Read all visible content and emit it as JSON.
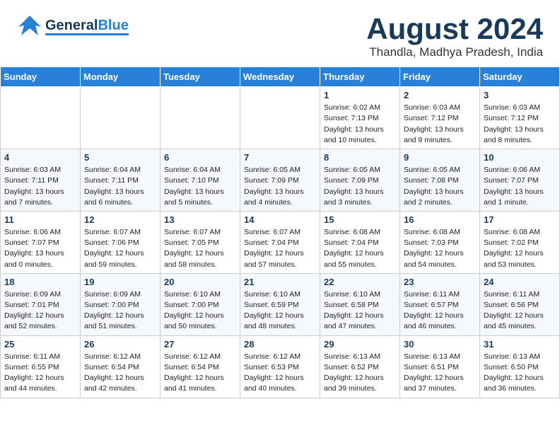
{
  "header": {
    "logo": {
      "general": "General",
      "blue": "Blue"
    },
    "month": "August 2024",
    "location": "Thandla, Madhya Pradesh, India"
  },
  "weekdays": [
    "Sunday",
    "Monday",
    "Tuesday",
    "Wednesday",
    "Thursday",
    "Friday",
    "Saturday"
  ],
  "weeks": [
    [
      {
        "day": "",
        "text": ""
      },
      {
        "day": "",
        "text": ""
      },
      {
        "day": "",
        "text": ""
      },
      {
        "day": "",
        "text": ""
      },
      {
        "day": "1",
        "text": "Sunrise: 6:02 AM\nSunset: 7:13 PM\nDaylight: 13 hours\nand 10 minutes."
      },
      {
        "day": "2",
        "text": "Sunrise: 6:03 AM\nSunset: 7:12 PM\nDaylight: 13 hours\nand 9 minutes."
      },
      {
        "day": "3",
        "text": "Sunrise: 6:03 AM\nSunset: 7:12 PM\nDaylight: 13 hours\nand 8 minutes."
      }
    ],
    [
      {
        "day": "4",
        "text": "Sunrise: 6:03 AM\nSunset: 7:11 PM\nDaylight: 13 hours\nand 7 minutes."
      },
      {
        "day": "5",
        "text": "Sunrise: 6:04 AM\nSunset: 7:11 PM\nDaylight: 13 hours\nand 6 minutes."
      },
      {
        "day": "6",
        "text": "Sunrise: 6:04 AM\nSunset: 7:10 PM\nDaylight: 13 hours\nand 5 minutes."
      },
      {
        "day": "7",
        "text": "Sunrise: 6:05 AM\nSunset: 7:09 PM\nDaylight: 13 hours\nand 4 minutes."
      },
      {
        "day": "8",
        "text": "Sunrise: 6:05 AM\nSunset: 7:09 PM\nDaylight: 13 hours\nand 3 minutes."
      },
      {
        "day": "9",
        "text": "Sunrise: 6:05 AM\nSunset: 7:08 PM\nDaylight: 13 hours\nand 2 minutes."
      },
      {
        "day": "10",
        "text": "Sunrise: 6:06 AM\nSunset: 7:07 PM\nDaylight: 13 hours\nand 1 minute."
      }
    ],
    [
      {
        "day": "11",
        "text": "Sunrise: 6:06 AM\nSunset: 7:07 PM\nDaylight: 13 hours\nand 0 minutes."
      },
      {
        "day": "12",
        "text": "Sunrise: 6:07 AM\nSunset: 7:06 PM\nDaylight: 12 hours\nand 59 minutes."
      },
      {
        "day": "13",
        "text": "Sunrise: 6:07 AM\nSunset: 7:05 PM\nDaylight: 12 hours\nand 58 minutes."
      },
      {
        "day": "14",
        "text": "Sunrise: 6:07 AM\nSunset: 7:04 PM\nDaylight: 12 hours\nand 57 minutes."
      },
      {
        "day": "15",
        "text": "Sunrise: 6:08 AM\nSunset: 7:04 PM\nDaylight: 12 hours\nand 55 minutes."
      },
      {
        "day": "16",
        "text": "Sunrise: 6:08 AM\nSunset: 7:03 PM\nDaylight: 12 hours\nand 54 minutes."
      },
      {
        "day": "17",
        "text": "Sunrise: 6:08 AM\nSunset: 7:02 PM\nDaylight: 12 hours\nand 53 minutes."
      }
    ],
    [
      {
        "day": "18",
        "text": "Sunrise: 6:09 AM\nSunset: 7:01 PM\nDaylight: 12 hours\nand 52 minutes."
      },
      {
        "day": "19",
        "text": "Sunrise: 6:09 AM\nSunset: 7:00 PM\nDaylight: 12 hours\nand 51 minutes."
      },
      {
        "day": "20",
        "text": "Sunrise: 6:10 AM\nSunset: 7:00 PM\nDaylight: 12 hours\nand 50 minutes."
      },
      {
        "day": "21",
        "text": "Sunrise: 6:10 AM\nSunset: 6:59 PM\nDaylight: 12 hours\nand 48 minutes."
      },
      {
        "day": "22",
        "text": "Sunrise: 6:10 AM\nSunset: 6:58 PM\nDaylight: 12 hours\nand 47 minutes."
      },
      {
        "day": "23",
        "text": "Sunrise: 6:11 AM\nSunset: 6:57 PM\nDaylight: 12 hours\nand 46 minutes."
      },
      {
        "day": "24",
        "text": "Sunrise: 6:11 AM\nSunset: 6:56 PM\nDaylight: 12 hours\nand 45 minutes."
      }
    ],
    [
      {
        "day": "25",
        "text": "Sunrise: 6:11 AM\nSunset: 6:55 PM\nDaylight: 12 hours\nand 44 minutes."
      },
      {
        "day": "26",
        "text": "Sunrise: 6:12 AM\nSunset: 6:54 PM\nDaylight: 12 hours\nand 42 minutes."
      },
      {
        "day": "27",
        "text": "Sunrise: 6:12 AM\nSunset: 6:54 PM\nDaylight: 12 hours\nand 41 minutes."
      },
      {
        "day": "28",
        "text": "Sunrise: 6:12 AM\nSunset: 6:53 PM\nDaylight: 12 hours\nand 40 minutes."
      },
      {
        "day": "29",
        "text": "Sunrise: 6:13 AM\nSunset: 6:52 PM\nDaylight: 12 hours\nand 39 minutes."
      },
      {
        "day": "30",
        "text": "Sunrise: 6:13 AM\nSunset: 6:51 PM\nDaylight: 12 hours\nand 37 minutes."
      },
      {
        "day": "31",
        "text": "Sunrise: 6:13 AM\nSunset: 6:50 PM\nDaylight: 12 hours\nand 36 minutes."
      }
    ]
  ]
}
